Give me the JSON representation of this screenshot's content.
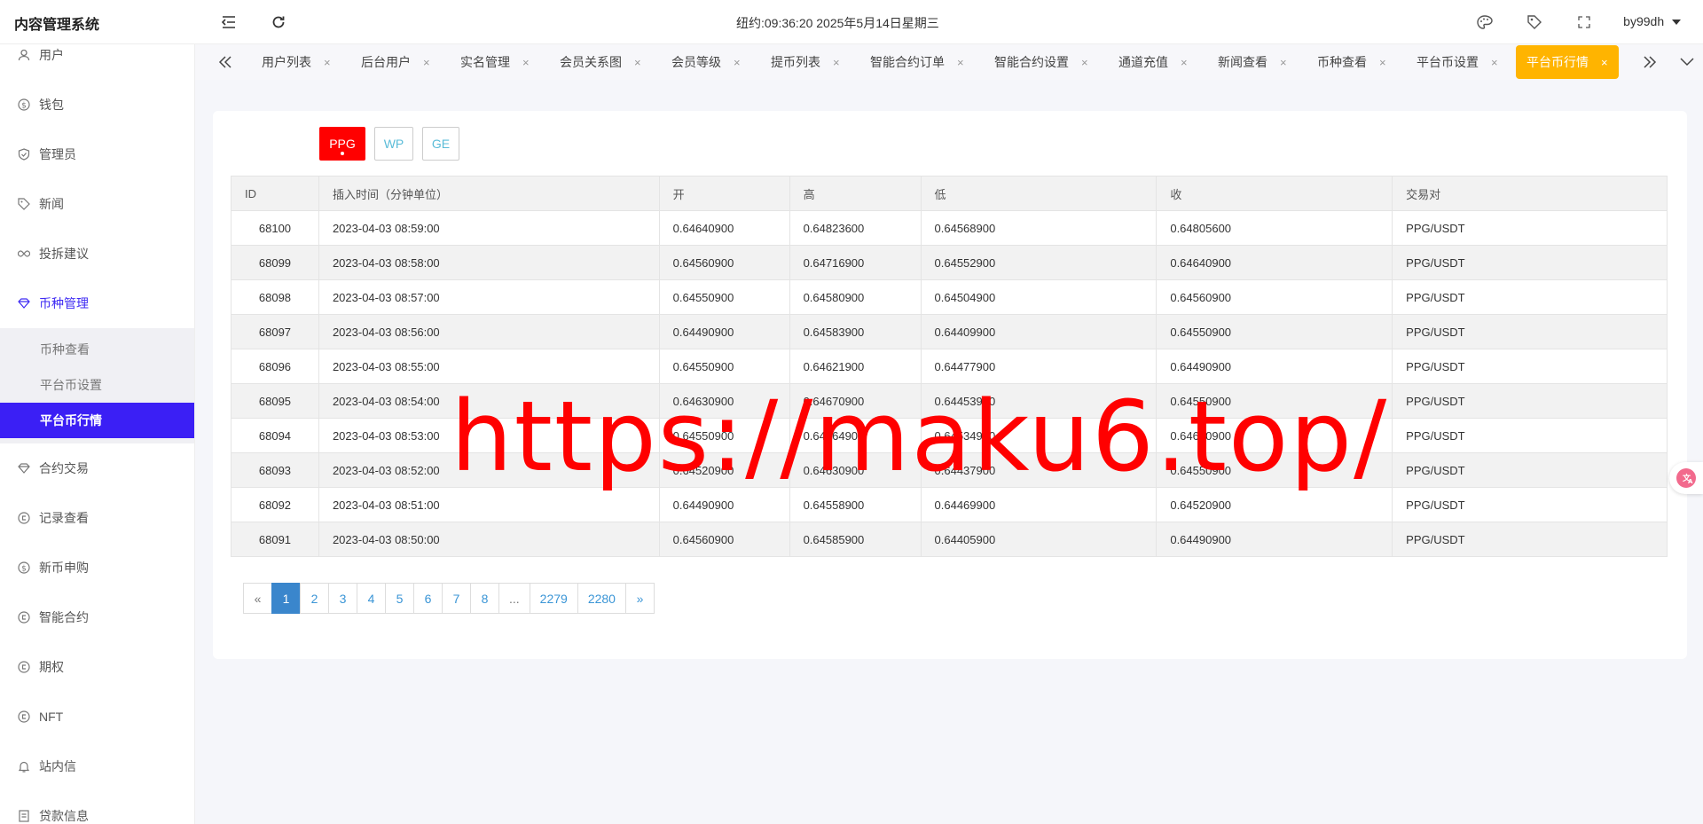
{
  "header": {
    "brand": "内容管理系统",
    "clock": "纽约:09:36:20 2025年5月14日星期三",
    "user": "by99dh"
  },
  "sidebar": {
    "items": [
      {
        "label": "用户",
        "icon": "user-icon"
      },
      {
        "label": "钱包",
        "icon": "dollar-icon"
      },
      {
        "label": "管理员",
        "icon": "shield-icon"
      },
      {
        "label": "新闻",
        "icon": "tag-icon"
      },
      {
        "label": "投拆建议",
        "icon": "infinity-icon"
      },
      {
        "label": "币种管理",
        "icon": "diamond-icon"
      }
    ],
    "sub": [
      "币种查看",
      "平台币设置",
      "平台币行情"
    ],
    "items_after": [
      {
        "label": "合约交易",
        "icon": "diamond-icon"
      },
      {
        "label": "记录查看",
        "icon": "cycle-icon"
      },
      {
        "label": "新币申购",
        "icon": "dollar-icon"
      },
      {
        "label": "智能合约",
        "icon": "cycle-icon"
      },
      {
        "label": "期权",
        "icon": "cycle-icon"
      },
      {
        "label": "NFT",
        "icon": "cycle-icon"
      },
      {
        "label": "站内信",
        "icon": "bell-icon"
      },
      {
        "label": "贷款信息",
        "icon": "doc-icon"
      }
    ]
  },
  "tabs": [
    "用户列表",
    "后台用户",
    "实名管理",
    "会员关系图",
    "会员等级",
    "提币列表",
    "智能合约订单",
    "智能合约设置",
    "通道充值",
    "新闻查看",
    "币种查看",
    "平台币设置",
    "平台币行情"
  ],
  "tab_close": "×",
  "coins": [
    "PPG",
    "WP",
    "GE"
  ],
  "table": {
    "headers": [
      "ID",
      "插入时间（分钟单位）",
      "开",
      "高",
      "低",
      "收",
      "交易对"
    ],
    "rows": [
      [
        "68100",
        "2023-04-03 08:59:00",
        "0.64640900",
        "0.64823600",
        "0.64568900",
        "0.64805600",
        "PPG/USDT"
      ],
      [
        "68099",
        "2023-04-03 08:58:00",
        "0.64560900",
        "0.64716900",
        "0.64552900",
        "0.64640900",
        "PPG/USDT"
      ],
      [
        "68098",
        "2023-04-03 08:57:00",
        "0.64550900",
        "0.64580900",
        "0.64504900",
        "0.64560900",
        "PPG/USDT"
      ],
      [
        "68097",
        "2023-04-03 08:56:00",
        "0.64490900",
        "0.64583900",
        "0.64409900",
        "0.64550900",
        "PPG/USDT"
      ],
      [
        "68096",
        "2023-04-03 08:55:00",
        "0.64550900",
        "0.64621900",
        "0.64477900",
        "0.64490900",
        "PPG/USDT"
      ],
      [
        "68095",
        "2023-04-03 08:54:00",
        "0.64630900",
        "0.64670900",
        "0.64453900",
        "0.64550900",
        "PPG/USDT"
      ],
      [
        "68094",
        "2023-04-03 08:53:00",
        "0.64550900",
        "0.64664900",
        "0.64534900",
        "0.64630900",
        "PPG/USDT"
      ],
      [
        "68093",
        "2023-04-03 08:52:00",
        "0.64520900",
        "0.64630900",
        "0.64437900",
        "0.64550900",
        "PPG/USDT"
      ],
      [
        "68092",
        "2023-04-03 08:51:00",
        "0.64490900",
        "0.64558900",
        "0.64469900",
        "0.64520900",
        "PPG/USDT"
      ],
      [
        "68091",
        "2023-04-03 08:50:00",
        "0.64560900",
        "0.64585900",
        "0.64405900",
        "0.64490900",
        "PPG/USDT"
      ]
    ]
  },
  "pager": [
    "«",
    "1",
    "2",
    "3",
    "4",
    "5",
    "6",
    "7",
    "8",
    "...",
    "2279",
    "2280",
    "»"
  ],
  "watermark": "https://maku6.top/",
  "colors": {
    "accent": "#3b1ff5",
    "active_tab": "#ffb400",
    "active_coin": "#ff0000",
    "pager_active": "#3a86cc"
  }
}
